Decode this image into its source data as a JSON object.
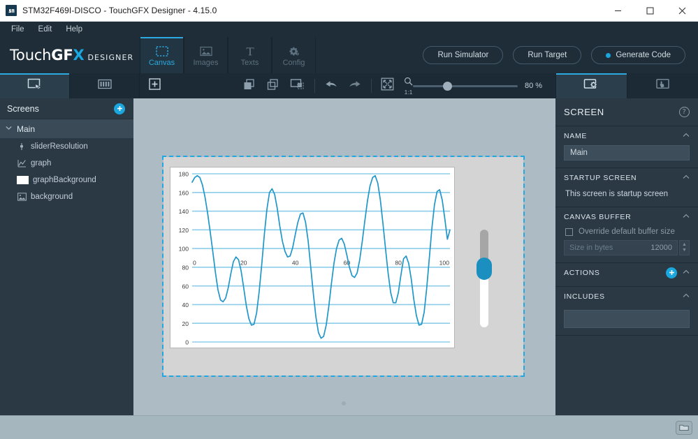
{
  "window": {
    "title": "STM32F469I-DISCO - TouchGFX Designer - 4.15.0",
    "app_icon": "stm-icon",
    "minimize": "–",
    "maximize": "□",
    "close": "✕"
  },
  "menubar": {
    "items": [
      {
        "label": "File"
      },
      {
        "label": "Edit"
      },
      {
        "label": "Help"
      }
    ]
  },
  "brand": {
    "logo_part1": "Touch",
    "logo_part2": "GF",
    "logo_x": "X",
    "logo_suffix": "DESIGNER"
  },
  "main_tabs": [
    {
      "label": "Canvas",
      "icon": "canvas-dotted-rect-icon",
      "active": true
    },
    {
      "label": "Images",
      "icon": "image-icon",
      "active": false
    },
    {
      "label": "Texts",
      "icon": "text-t-icon",
      "active": false
    },
    {
      "label": "Config",
      "icon": "gear-icon",
      "active": false
    }
  ],
  "run_buttons": [
    {
      "label": "Run Simulator",
      "has_dot": false
    },
    {
      "label": "Run Target",
      "has_dot": false
    },
    {
      "label": "Generate Code",
      "has_dot": true,
      "dot_color": "#1ba7de"
    }
  ],
  "toolbar": {
    "select_tool": "select-cursor-icon",
    "widgets_tool": "widgets-icon",
    "add_widget": "add-plus-icon",
    "align_front": "bring-to-front-icon",
    "align_back": "send-to-back-icon",
    "align_group": "group-icon",
    "undo": "undo-arrow-icon",
    "redo": "redo-arrow-icon",
    "fit_screen": "fit-to-screen-icon",
    "zoom_reset_label": "1:1",
    "zoom_reset_icon": "magnifier-icon",
    "zoom_percent": "80 %",
    "zoom_slider_value": 80
  },
  "right_tabs": [
    {
      "icon": "screen-settings-icon",
      "active": true
    },
    {
      "icon": "interactions-icon",
      "active": false
    }
  ],
  "sidebar": {
    "header": "Screens",
    "add_icon": "plus-circle-icon",
    "screen": {
      "label": "Main",
      "caret": "⌄",
      "expanded": true
    },
    "items": [
      {
        "label": "sliderResolution",
        "icon": "slider-icon"
      },
      {
        "label": "graph",
        "icon": "graph-line-icon"
      },
      {
        "label": "graphBackground",
        "icon": "box-white-icon"
      },
      {
        "label": "background",
        "icon": "image-thumb-icon"
      }
    ]
  },
  "properties": {
    "title": "SCREEN",
    "help_icon": "question-icon",
    "name_section": {
      "title": "NAME",
      "value": "Main",
      "collapse_icon": "chevron-up-icon"
    },
    "startup_section": {
      "title": "STARTUP SCREEN",
      "text": "This screen is startup screen",
      "collapse_icon": "chevron-up-icon"
    },
    "canvas_buffer_section": {
      "title": "CANVAS BUFFER",
      "checkbox_label": "Override default buffer size",
      "checked": false,
      "size_placeholder": "Size in bytes",
      "size_value": "12000",
      "collapse_icon": "chevron-up-icon"
    },
    "actions_section": {
      "title": "ACTIONS",
      "add_icon": "plus-circle-icon",
      "collapse_icon": "chevron-up-icon"
    },
    "includes_section": {
      "title": "INCLUDES",
      "value": "",
      "collapse_icon": "chevron-up-icon"
    }
  },
  "canvas": {
    "selection_color": "#22a7e0",
    "screen_bg": "#d4d4d4",
    "workspace_bg": "#adbcc4",
    "slider": {
      "name": "sliderResolution",
      "knob_color": "#1b8fc0",
      "track_top_color": "#a6a6a6",
      "track_bottom_color": "#ffffff"
    }
  },
  "bottombar": {
    "folder_icon": "folder-icon"
  },
  "chart_data": {
    "type": "line",
    "title": "",
    "xlabel": "",
    "ylabel": "",
    "line_color": "#2196c9",
    "grid_color": "#8ecdea",
    "grid": true,
    "xlim": [
      0,
      100
    ],
    "ylim": [
      0,
      180
    ],
    "xticks": [
      0,
      20,
      40,
      60,
      80,
      100
    ],
    "yticks": [
      0,
      20,
      40,
      60,
      80,
      100,
      120,
      140,
      160,
      180
    ],
    "series": [
      {
        "name": "graph",
        "x": [
          0,
          1,
          2,
          3,
          4,
          5,
          6,
          7,
          8,
          9,
          10,
          11,
          12,
          13,
          14,
          15,
          16,
          17,
          18,
          19,
          20,
          21,
          22,
          23,
          24,
          25,
          26,
          27,
          28,
          29,
          30,
          31,
          32,
          33,
          34,
          35,
          36,
          37,
          38,
          39,
          40,
          41,
          42,
          43,
          44,
          45,
          46,
          47,
          48,
          49,
          50,
          51,
          52,
          53,
          54,
          55,
          56,
          57,
          58,
          59,
          60,
          61,
          62,
          63,
          64,
          65,
          66,
          67,
          68,
          69,
          70,
          71,
          72,
          73,
          74,
          75,
          76,
          77,
          78,
          79,
          80,
          81,
          82,
          83,
          84,
          85,
          86,
          87,
          88,
          89,
          90,
          91,
          92,
          93,
          94,
          95,
          96,
          97,
          98,
          99,
          100
        ],
        "y": [
          171,
          176,
          178,
          176,
          168,
          155,
          138,
          118,
          97,
          75,
          56,
          45,
          43,
          47,
          58,
          73,
          86,
          91,
          88,
          76,
          58,
          39,
          25,
          18,
          19,
          31,
          54,
          83,
          115,
          142,
          160,
          164,
          158,
          143,
          124,
          108,
          97,
          91,
          92,
          101,
          115,
          128,
          137,
          138,
          128,
          108,
          80,
          52,
          27,
          10,
          4,
          6,
          18,
          38,
          62,
          84,
          100,
          109,
          111,
          105,
          93,
          80,
          71,
          69,
          74,
          88,
          108,
          130,
          151,
          167,
          176,
          178,
          170,
          152,
          127,
          100,
          74,
          53,
          42,
          42,
          53,
          72,
          89,
          92,
          84,
          67,
          45,
          28,
          18,
          19,
          32,
          58,
          90,
          122,
          147,
          161,
          163,
          152,
          132,
          110,
          120
        ]
      }
    ]
  }
}
